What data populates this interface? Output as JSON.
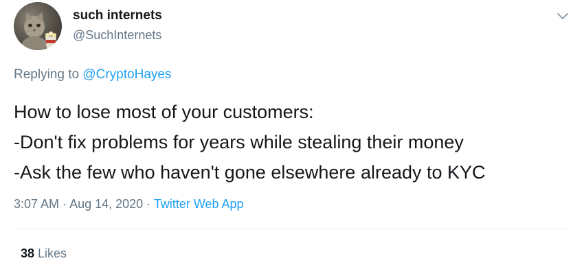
{
  "author": {
    "display_name": "such internets",
    "handle": "@SuchInternets",
    "avatar_icon": "cat-with-popcorn-avatar"
  },
  "reply": {
    "prefix": "Replying to ",
    "mention": "@CryptoHayes"
  },
  "body_lines": [
    "How to lose most of your customers:",
    "-Don't fix problems for years while stealing their money",
    "-Ask the few who haven't gone elsewhere already to KYC"
  ],
  "meta": {
    "time": "3:07 AM",
    "separator": " · ",
    "date": "Aug 14, 2020",
    "source": "Twitter Web App"
  },
  "stats": {
    "likes_count": "38",
    "likes_label": " Likes"
  },
  "icons": {
    "menu": "chevron-down-icon"
  },
  "colors": {
    "accent": "#1da1f2",
    "text_primary": "#14171a",
    "text_secondary": "#657786",
    "divider": "#e6ecf0"
  }
}
